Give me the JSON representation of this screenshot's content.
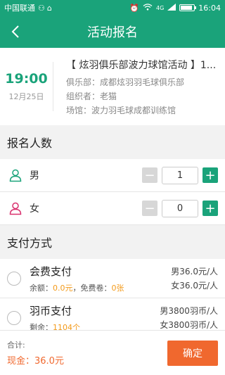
{
  "status_bar": {
    "carrier": "中国联通",
    "time": "16:04",
    "network": "4G",
    "battery_level": 0.9
  },
  "nav": {
    "title": "活动报名"
  },
  "event": {
    "time": "19:00",
    "date": "12月25日",
    "name": "【 炫羽俱乐部波力球馆活动 】1...",
    "club_label": "俱乐部：",
    "club": "成都炫羽羽毛球俱乐部",
    "organizer_label": "组织者：",
    "organizer": "老猫",
    "venue_label": "场馆：",
    "venue": "波力羽毛球成都训练馆"
  },
  "signup": {
    "header": "报名人数",
    "male_label": "男",
    "male_count": "1",
    "female_label": "女",
    "female_count": "0",
    "minus": "−",
    "plus": "+"
  },
  "payment": {
    "header": "支付方式",
    "member": {
      "name": "会费支付",
      "balance_label": "余额：",
      "balance": "0.0元",
      "coupon_label": "，免费卷：",
      "coupon": "0张",
      "price_male": "男36.0元/人",
      "price_female": "女36.0元/人"
    },
    "coin": {
      "name": "羽币支付",
      "remain_label": "剩余：",
      "remain": "1104个",
      "price_male": "男3800羽币/人",
      "price_female": "女3800羽币/人"
    }
  },
  "footer": {
    "total_label": "合计:",
    "amount": "现金：36.0元",
    "confirm": "确定"
  },
  "colors": {
    "primary": "#1aa37a",
    "accent": "#f0682e",
    "highlight": "#f39a1a"
  }
}
